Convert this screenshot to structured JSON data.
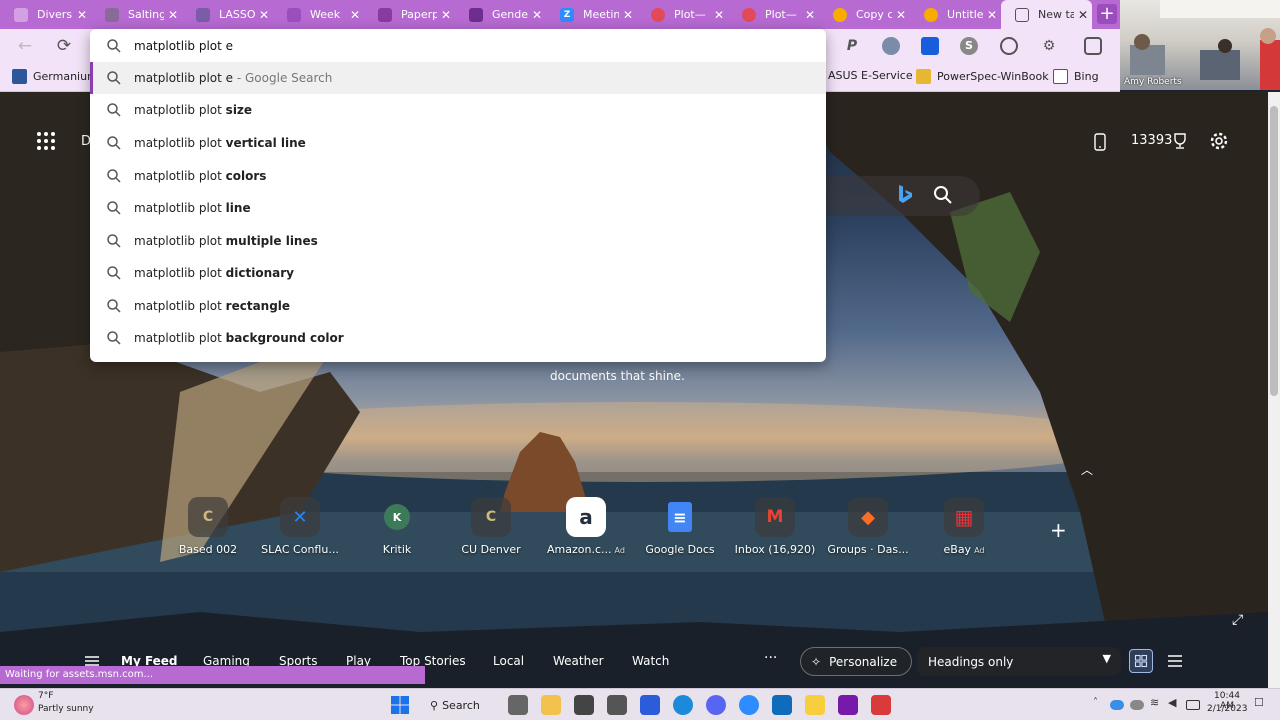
{
  "browser": {
    "tabs": [
      {
        "title": "Diversi",
        "favicon_color": "#d4a0e4"
      },
      {
        "title": "Saltingr",
        "favicon_color": "#8a6a98"
      },
      {
        "title": "LASSO",
        "favicon_color": "#7a5ca8"
      },
      {
        "title": "Week",
        "favicon_color": "#9b4fbf"
      },
      {
        "title": "Paperp",
        "favicon_color": "#8a3a9e"
      },
      {
        "title": "Gende",
        "favicon_color": "#6f2d8f"
      },
      {
        "title": "Meetin",
        "favicon_color": "#2d8cff"
      },
      {
        "title": "Plot—",
        "favicon_color": "#e24a5a"
      },
      {
        "title": "Plot—",
        "favicon_color": "#e24a5a"
      },
      {
        "title": "Copy c",
        "favicon_color": "#f9ab00"
      },
      {
        "title": "Untitle",
        "favicon_color": "#f9ab00"
      },
      {
        "title": "New ta",
        "favicon_color": "#555555",
        "active": true
      }
    ],
    "new_tab_button": "+",
    "toolbar": {
      "back": "←",
      "refresh": "⟳"
    },
    "extensions": [
      "P",
      "S"
    ],
    "favorites": [
      {
        "label": "Germanium",
        "color": "#2b579a"
      },
      {
        "label": "ASUS E-Service",
        "color": "#f3e3f8"
      },
      {
        "label": "PowerSpec-WinBook",
        "color": "#e8b731"
      },
      {
        "label": "Bing",
        "color": "#f3e3f8"
      }
    ]
  },
  "webcam": {
    "name": "Amy Roberts"
  },
  "omnibox": {
    "query": "matplotlib plot e",
    "suggestions": [
      {
        "prefix": "matplotlib plot e",
        "bold": "",
        "hint": " - Google Search",
        "highlighted": true
      },
      {
        "prefix": "matplotlib plot ",
        "bold": "size"
      },
      {
        "prefix": "matplotlib plot ",
        "bold": "vertical line"
      },
      {
        "prefix": "matplotlib plot ",
        "bold": "colors"
      },
      {
        "prefix": "matplotlib plot ",
        "bold": "line"
      },
      {
        "prefix": "matplotlib plot ",
        "bold": "multiple lines"
      },
      {
        "prefix": "matplotlib plot ",
        "bold": "dictionary"
      },
      {
        "prefix": "matplotlib plot ",
        "bold": "rectangle"
      },
      {
        "prefix": "matplotlib plot ",
        "bold": "background color"
      }
    ]
  },
  "ntp": {
    "top_left_letter": "D",
    "rewards_points": "13393",
    "promo_text": "documents that shine.",
    "quick_links": [
      {
        "label": "Based 002",
        "icon": "C",
        "color": "#cfb87c",
        "ad": ""
      },
      {
        "label": "SLAC Conflu...",
        "icon": "✕",
        "color": "#2684ff",
        "ad": ""
      },
      {
        "label": "Kritik",
        "icon": "K",
        "color": "#3d7a5a",
        "ad": ""
      },
      {
        "label": "CU Denver",
        "icon": "C",
        "color": "#cfb87c",
        "ad": ""
      },
      {
        "label": "Amazon.c...",
        "icon": "a",
        "color": "#232f3e",
        "ad": "Ad"
      },
      {
        "label": "Google Docs",
        "icon": "≡",
        "color": "#4285f4",
        "ad": ""
      },
      {
        "label": "Inbox (16,920)",
        "icon": "M",
        "color": "#ea4335",
        "ad": ""
      },
      {
        "label": "Groups · Das...",
        "icon": "◆",
        "color": "#fc6d26",
        "ad": ""
      },
      {
        "label": "eBay",
        "icon": "▦",
        "color": "#e53238",
        "ad": "Ad"
      }
    ],
    "add_site": "+"
  },
  "feed_nav": {
    "items": [
      "My Feed",
      "Gaming",
      "Sports",
      "Play",
      "Top Stories",
      "Local",
      "Weather",
      "Watch"
    ],
    "more": "···",
    "personalize": "Personalize",
    "headings": "Headings only"
  },
  "status_bar": "Waiting for assets.msn.com...",
  "taskbar": {
    "weather_temp": "7°F",
    "weather_desc": "Partly sunny",
    "search": "Search",
    "time": "10:44 AM",
    "date": "2/1/2023"
  },
  "colors": {
    "tab_bar": "#b66ad2",
    "toolbar": "#f3e3f8",
    "accent": "#8a3fb0"
  }
}
